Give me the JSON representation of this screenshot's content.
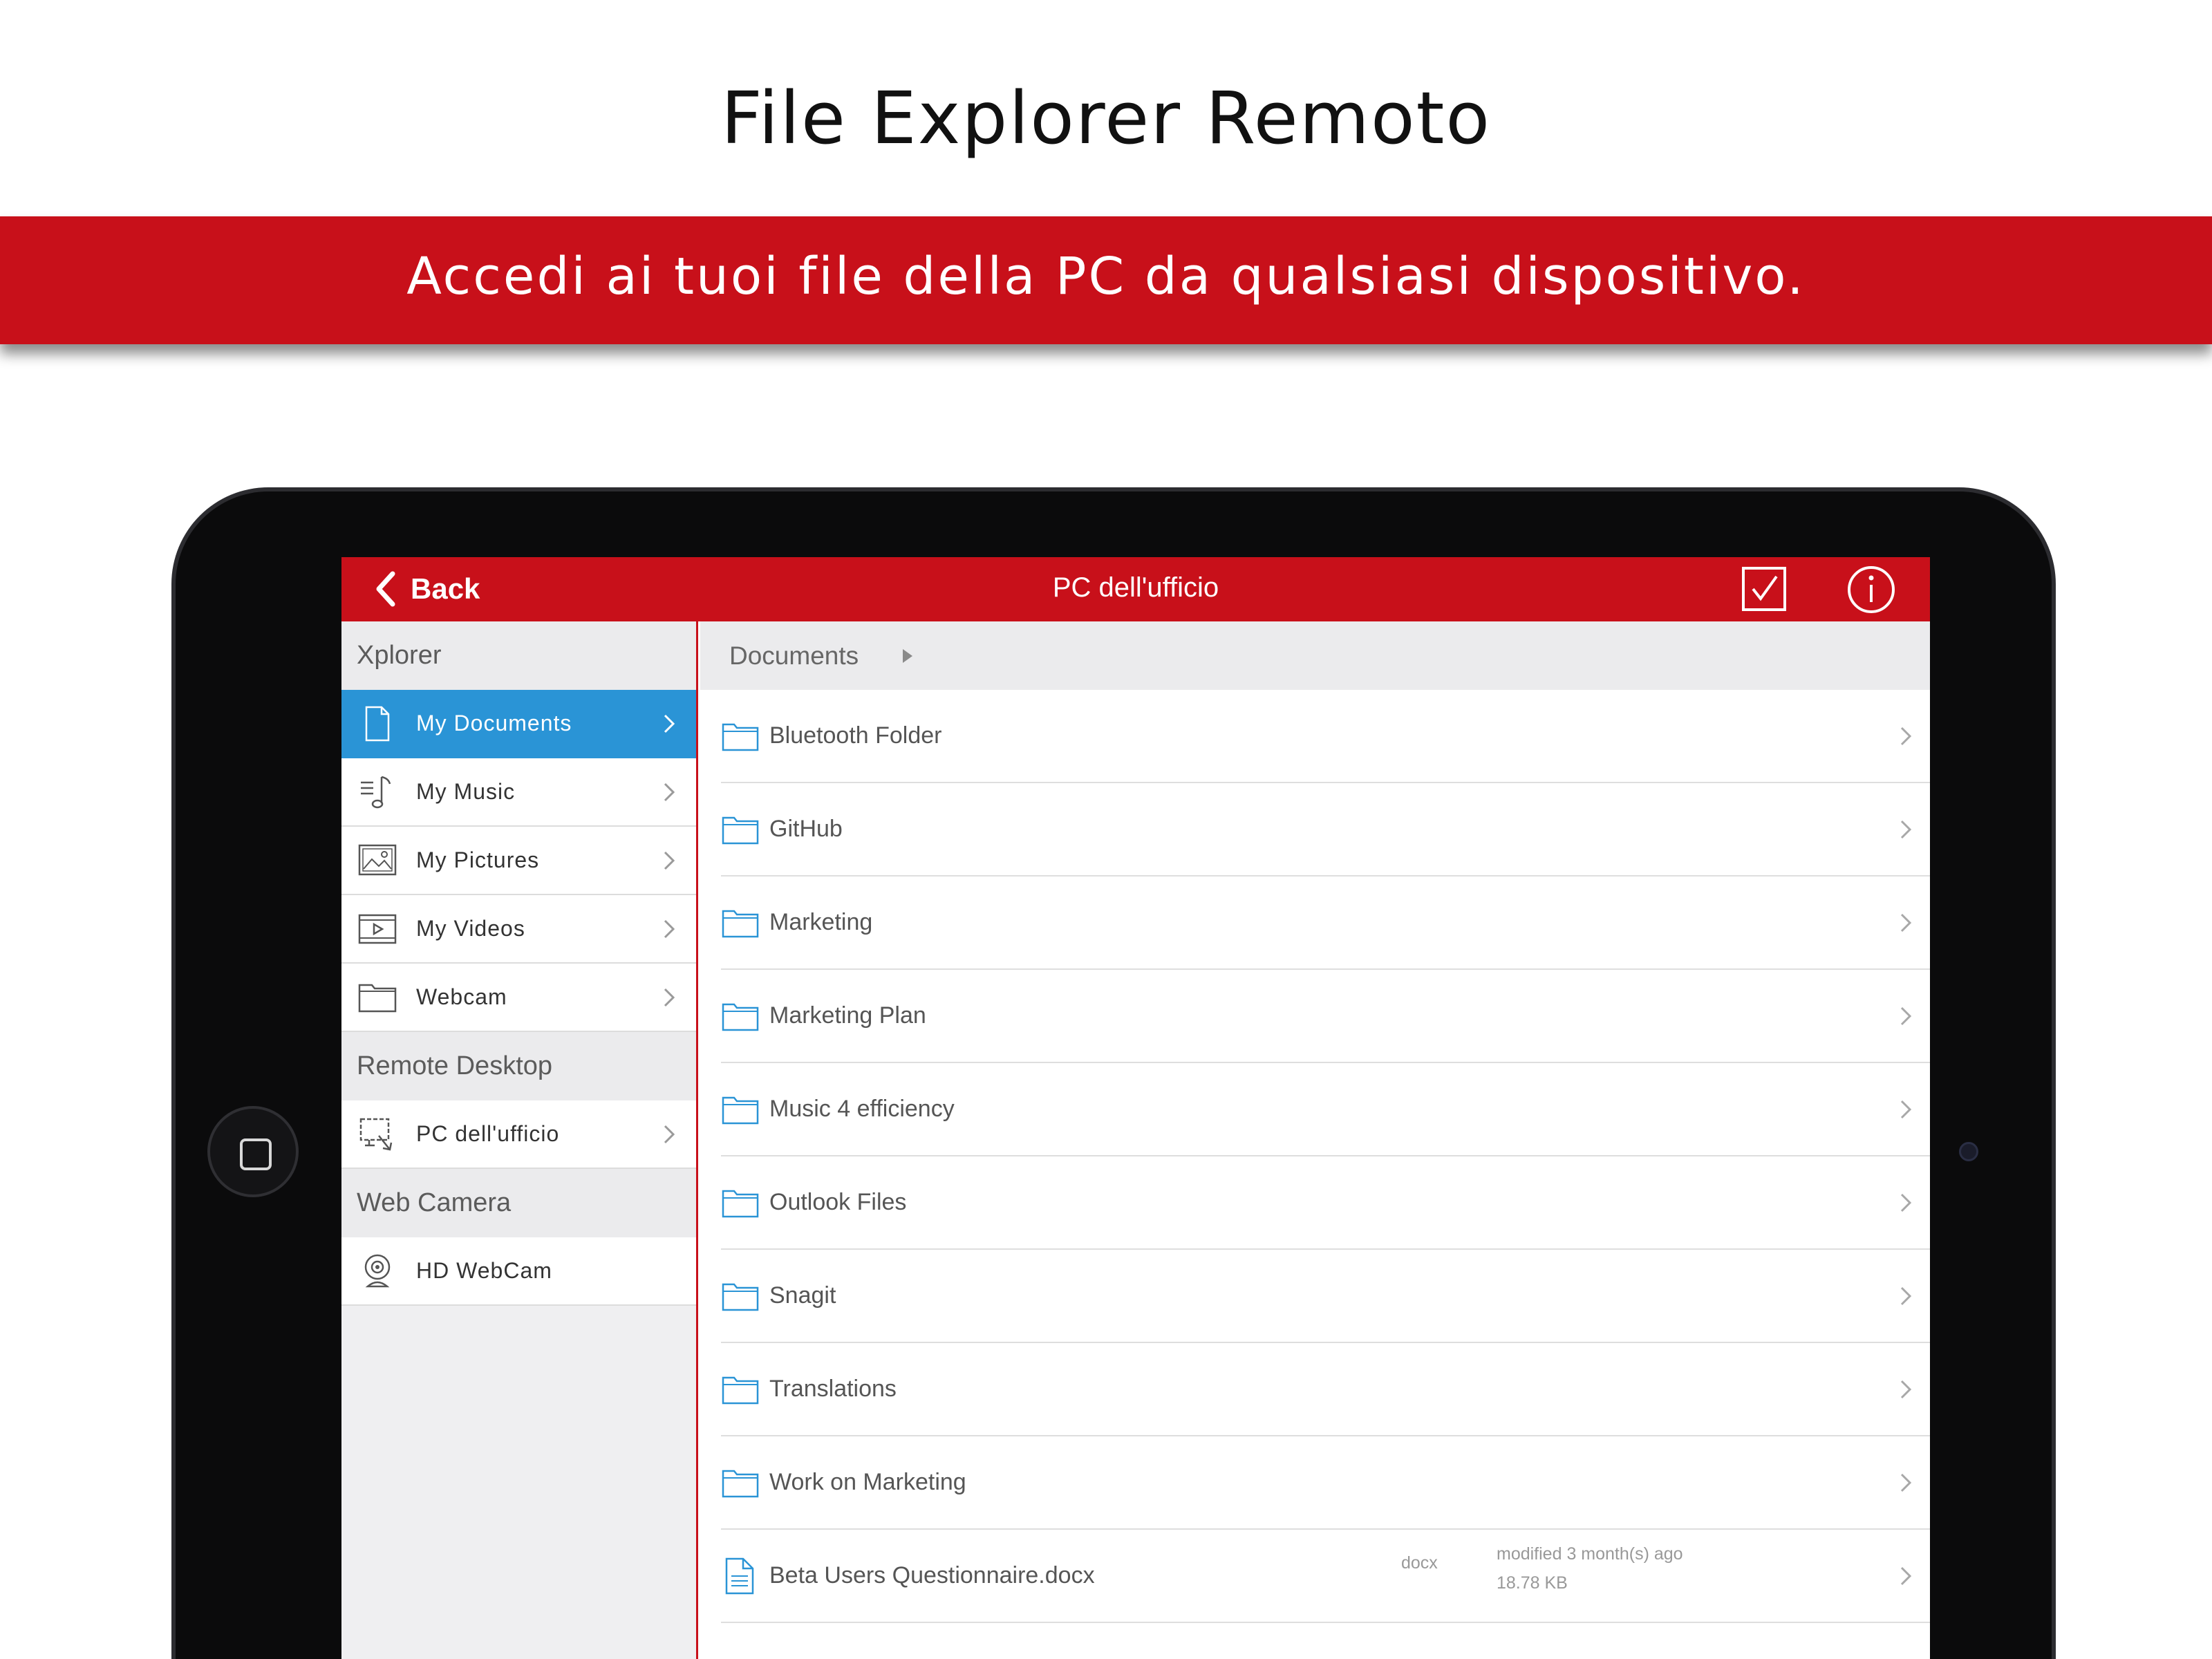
{
  "promo": {
    "headline": "File Explorer Remoto",
    "tagline": "Accedi ai tuoi file della PC da qualsiasi dispositivo.",
    "accent_color": "#c8101a"
  },
  "navbar": {
    "back_label": "Back",
    "title": "PC dell'ufficio",
    "check_icon": "checkbox-icon",
    "info_icon": "info-icon"
  },
  "sidebar": {
    "sections": [
      {
        "header": "Xplorer",
        "items": [
          {
            "label": "My Documents",
            "icon": "document-icon",
            "active": true
          },
          {
            "label": "My Music",
            "icon": "music-icon",
            "active": false
          },
          {
            "label": "My Pictures",
            "icon": "picture-icon",
            "active": false
          },
          {
            "label": "My Videos",
            "icon": "video-icon",
            "active": false
          },
          {
            "label": "Webcam",
            "icon": "folder-icon",
            "active": false
          }
        ]
      },
      {
        "header": "Remote Desktop",
        "items": [
          {
            "label": "PC dell'ufficio",
            "icon": "remote-desktop-icon",
            "active": false
          }
        ]
      },
      {
        "header": "Web Camera",
        "items": [
          {
            "label": "HD WebCam",
            "icon": "webcam-icon",
            "active": false
          }
        ]
      }
    ],
    "active_color": "#2a94d6"
  },
  "main": {
    "breadcrumb": "Documents",
    "folders": [
      "Bluetooth Folder",
      "GitHub",
      "Marketing",
      "Marketing Plan",
      "Music 4 efficiency",
      "Outlook Files",
      "Snagit",
      "Translations",
      "Work on Marketing"
    ],
    "files": [
      {
        "name": "Beta Users Questionnaire.docx",
        "ext": "docx",
        "modified": "modified 3 month(s) ago",
        "size": "18.78 KB"
      }
    ]
  }
}
